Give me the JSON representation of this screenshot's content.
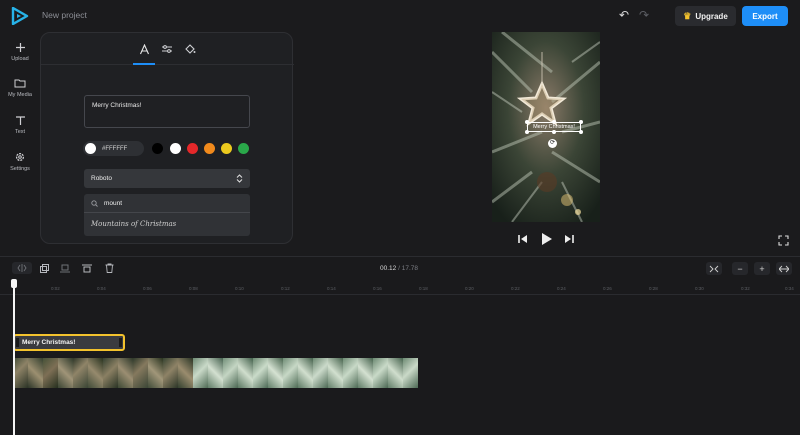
{
  "header": {
    "project_title": "New project",
    "upgrade_label": "Upgrade",
    "export_label": "Export"
  },
  "sidebar": {
    "items": [
      {
        "label": "Upload",
        "icon": "plus-icon"
      },
      {
        "label": "My Media",
        "icon": "folder-icon"
      },
      {
        "label": "Text",
        "icon": "text-icon"
      },
      {
        "label": "Settings",
        "icon": "gear-icon"
      }
    ]
  },
  "text_panel": {
    "tabs": [
      "text-style-icon",
      "adjust-icon",
      "fill-color-icon"
    ],
    "text_value": "Merry Christmas!",
    "current_color": "#FFFFFF",
    "swatches": [
      "#000000",
      "#ffffff",
      "#e5282a",
      "#f18a1c",
      "#ecca1e",
      "#2aa84a"
    ],
    "font": "Roboto",
    "font_search": "mount",
    "font_option": "Mountains of Christmas"
  },
  "preview": {
    "overlay_text": "Merry Christmas!"
  },
  "timeline": {
    "current_time": "00.12",
    "separator": "/",
    "total_time": "17.78",
    "ticks": [
      "0:02",
      "0:04",
      "0:06",
      "0:08",
      "0:10",
      "0:12",
      "0:14",
      "0:16",
      "0:18",
      "0:20",
      "0:22",
      "0:24",
      "0:26",
      "0:28",
      "0:30",
      "0:32",
      "0:34"
    ],
    "text_clip_label": "Merry Christmas!"
  },
  "colors": {
    "accent": "#1e8ef7",
    "clip_border": "#f3c22d"
  }
}
